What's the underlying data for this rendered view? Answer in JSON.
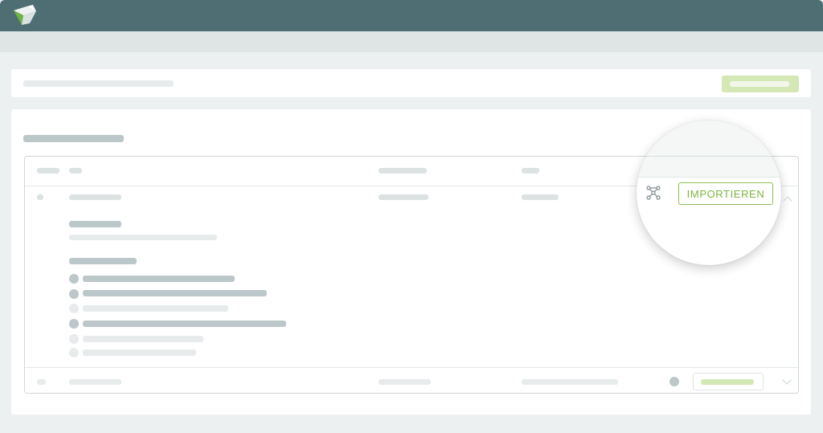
{
  "app": {
    "logo_icon": "envelope-logo-icon"
  },
  "colors": {
    "topbar": "#4e6e74",
    "accent_green": "#8dbf4c",
    "placeholder_dark": "#bcc7c9",
    "placeholder_light": "#e7ebec"
  },
  "magnifier": {
    "icon": "network-icon",
    "import_label": "IMPORTIEREN"
  }
}
